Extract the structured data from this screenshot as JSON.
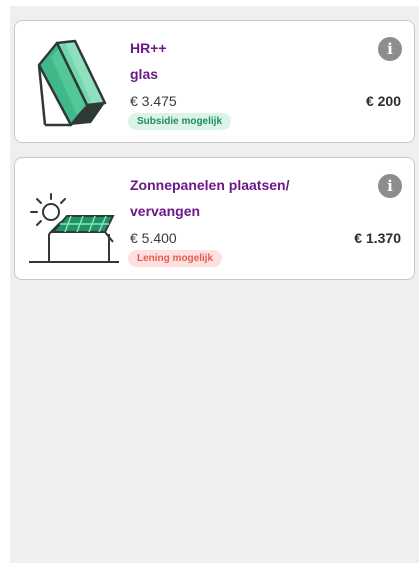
{
  "cards": [
    {
      "title_line1": "HR++",
      "title_line2": "glas",
      "price": "€ 3.475",
      "saving": "€ 200",
      "badge": "Subsidie mogelijk",
      "icon": "double-glazing-icon",
      "info_icon": "i"
    },
    {
      "title_line1": "Zonnepanelen plaatsen/",
      "title_line2": "vervangen",
      "price": "€ 5.400",
      "saving": "€ 1.370",
      "badge": "Lening mogelijk",
      "icon": "solar-panel-house-icon",
      "info_icon": "i"
    }
  ],
  "colors": {
    "title": "#6a1a86",
    "badge_green_bg": "#dcf3ea",
    "badge_green_text": "#1f8c5a",
    "badge_red_bg": "#fde0df",
    "badge_red_text": "#e35c50",
    "panel_bg": "#efeff1"
  }
}
